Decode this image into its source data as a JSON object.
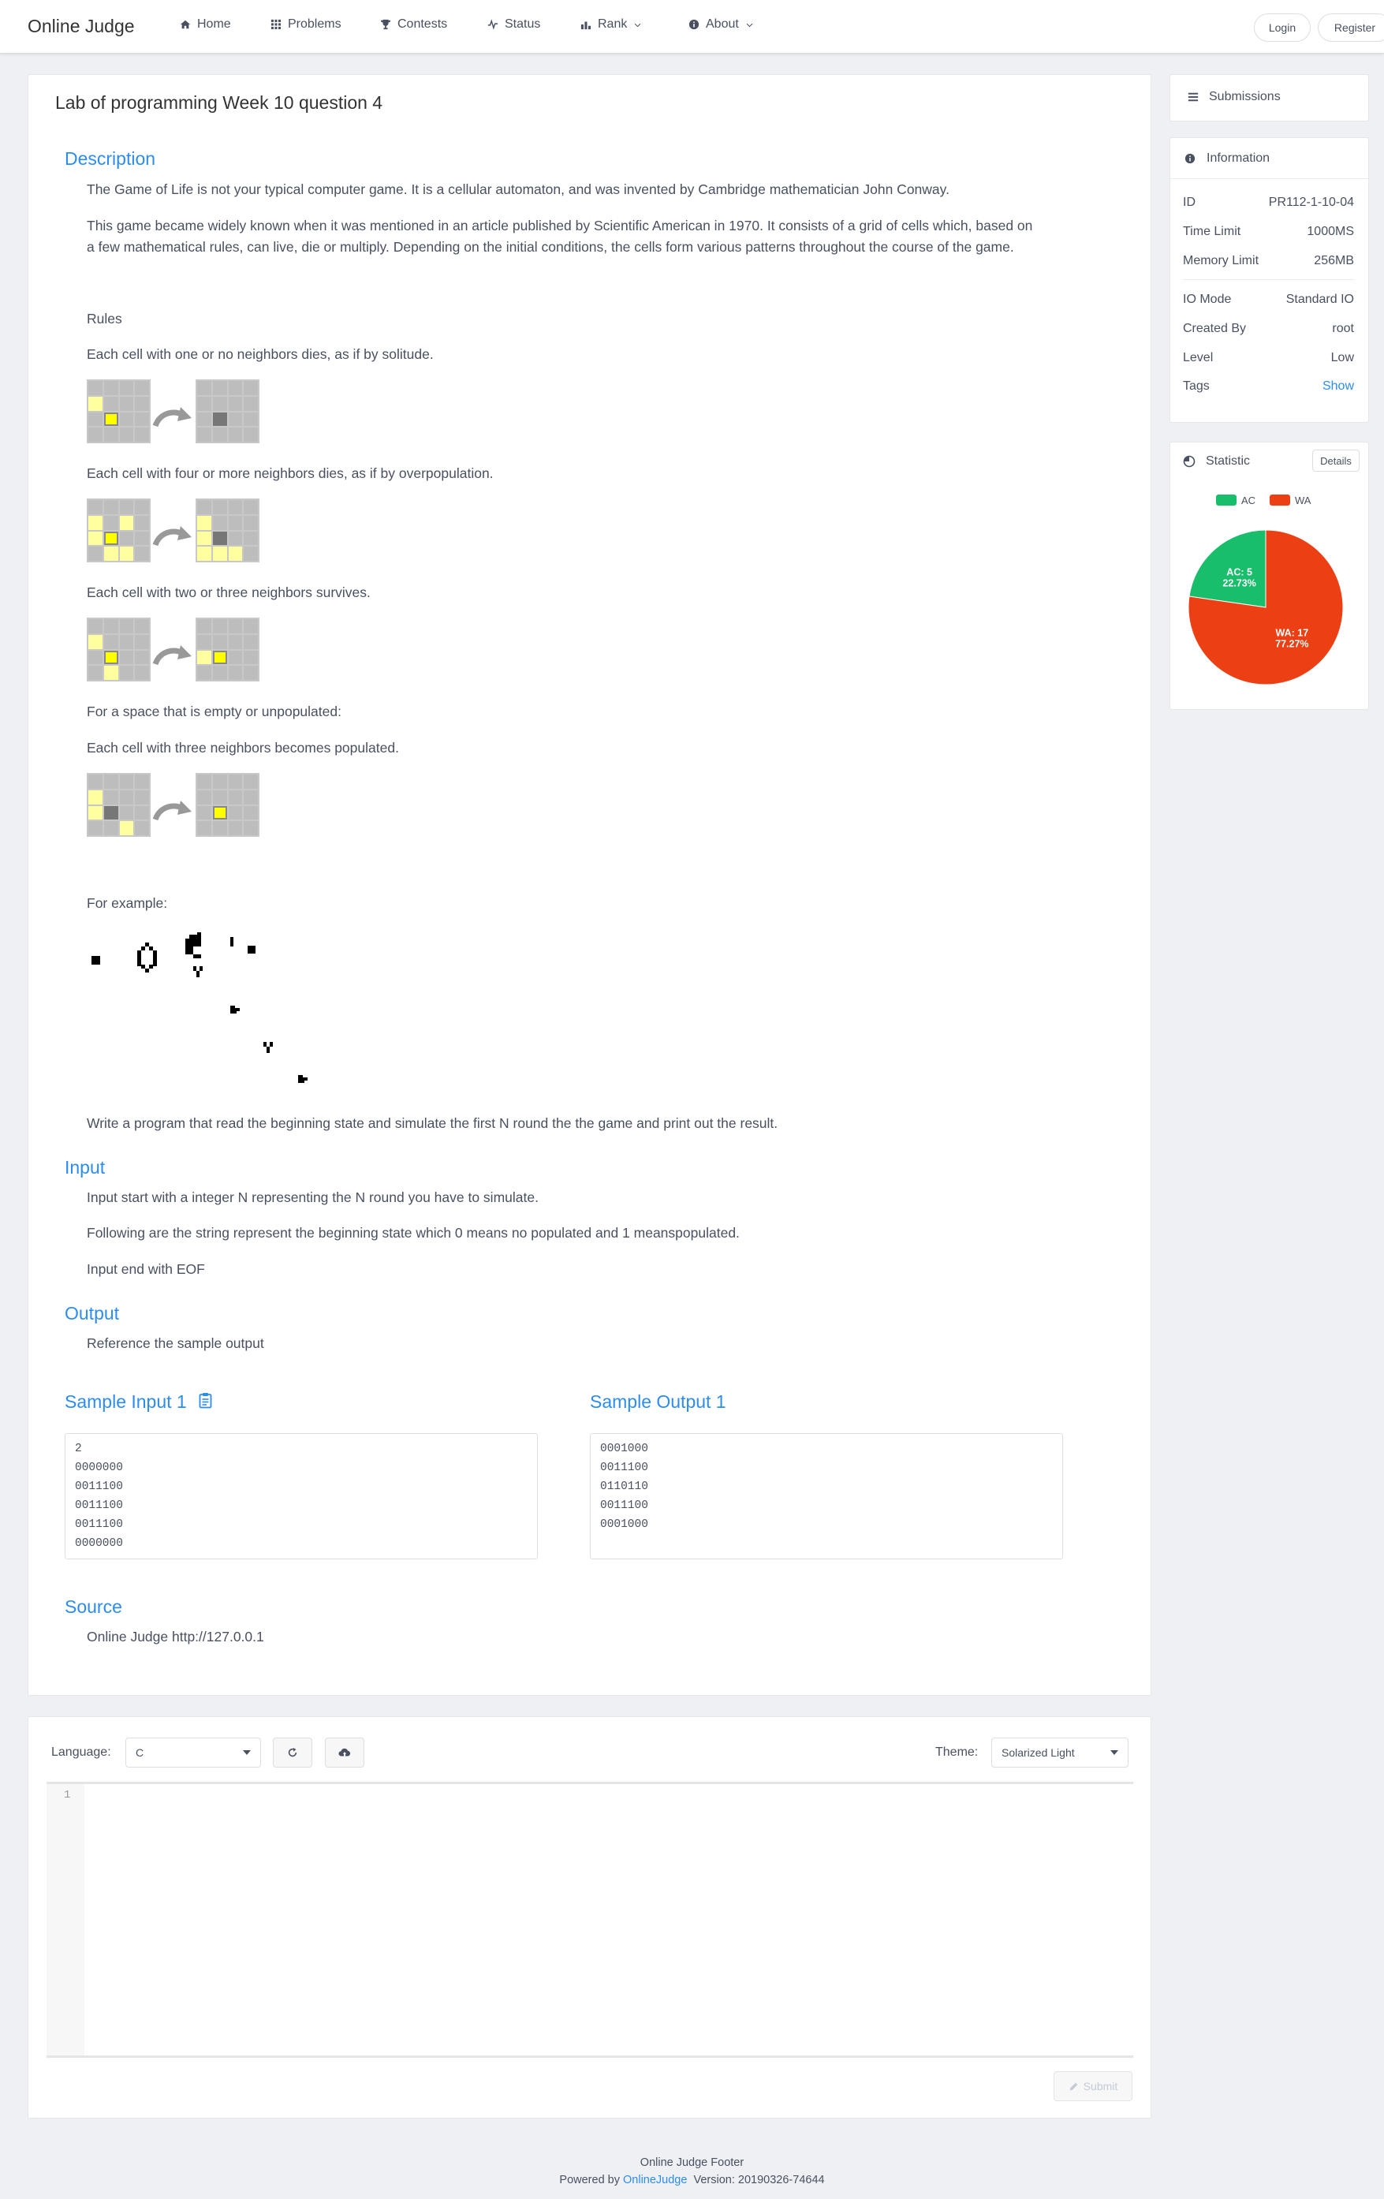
{
  "nav": {
    "logo": "Online Judge",
    "items": [
      {
        "label": "Home",
        "icon": "home-icon"
      },
      {
        "label": "Problems",
        "icon": "grid-icon"
      },
      {
        "label": "Contests",
        "icon": "trophy-icon"
      },
      {
        "label": "Status",
        "icon": "pulse-icon"
      },
      {
        "label": "Rank",
        "icon": "bar-chart-icon"
      },
      {
        "label": "About",
        "icon": "info-icon"
      }
    ],
    "login": "Login",
    "register": "Register"
  },
  "problem": {
    "title": "Lab of programming Week 10 question 4",
    "description_heading": "Description",
    "desc_p1": "The Game of Life is not your typical computer game. It is a cellular automaton, and was invented by Cambridge mathematician John Conway.",
    "desc_p2a": "This game became widely known when it was mentioned in an article published by Scientific American in 1970. It consists of a grid of cells which, based on",
    "desc_p2b": "a few mathematical rules, can live, die or multiply. Depending on the initial conditions, the cells form various patterns throughout the course of the game.",
    "rules": "Rules",
    "rule1": "Each cell with one or no neighbors dies, as if by solitude.",
    "rule2": "Each cell with four or more neighbors dies, as if by overpopulation.",
    "rule3": "Each cell with two or three neighbors survives.",
    "rule4": "For a space that is empty or unpopulated:",
    "rule5": "Each cell with three neighbors becomes populated.",
    "example": "For example:",
    "task": "Write a program that read the beginning state and simulate the first N round the the game and print out the result.",
    "input_heading": "Input",
    "input_p1": "Input start with a integer N representing the N round you have to simulate.",
    "input_p2": "Following are the string represent the beginning state which 0 means no populated and 1 meanspopulated.",
    "input_p3": "Input end with EOF",
    "output_heading": "Output",
    "output_p1": "Reference the sample output",
    "sample_input_heading": "Sample Input 1",
    "sample_output_heading": "Sample Output 1",
    "sample_input": "2\n0000000\n0011100\n0011100\n0011100\n0000000",
    "sample_output": "0001000\n0011100\n0110110\n0011100\n0001000",
    "source_heading": "Source",
    "source": "Online Judge http://127.0.0.1"
  },
  "editor": {
    "language_label": "Language:",
    "language_value": "C",
    "theme_label": "Theme:",
    "theme_value": "Solarized Light",
    "line_number": "1",
    "submit": "Submit"
  },
  "sidebar": {
    "submissions": "Submissions",
    "info_title": "Information",
    "info": [
      {
        "k": "ID",
        "v": "PR112-1-10-04"
      },
      {
        "k": "Time Limit",
        "v": "1000MS"
      },
      {
        "k": "Memory Limit",
        "v": "256MB"
      },
      {
        "k": "IO Mode",
        "v": "Standard IO"
      },
      {
        "k": "Created By",
        "v": "root"
      },
      {
        "k": "Level",
        "v": "Low"
      },
      {
        "k": "Tags",
        "v": "Show"
      }
    ],
    "statistic_title": "Statistic",
    "details": "Details"
  },
  "chart_data": {
    "type": "pie",
    "legend": [
      "AC",
      "WA"
    ],
    "values": [
      5,
      17
    ],
    "percent": [
      "22.73%",
      "77.27%"
    ],
    "labels": [
      "AC: 5",
      "WA: 17"
    ],
    "colors": [
      "#19be6b",
      "#ed3f14"
    ],
    "legend_position": "top"
  },
  "footer": {
    "line1": "Online Judge Footer",
    "powered": "Powered by",
    "link": "OnlineJudge",
    "version": "Version: 20190326-74644"
  },
  "colors": {
    "accent": "#2d8cf0",
    "text": "#495060",
    "bg": "#eef0f3"
  }
}
